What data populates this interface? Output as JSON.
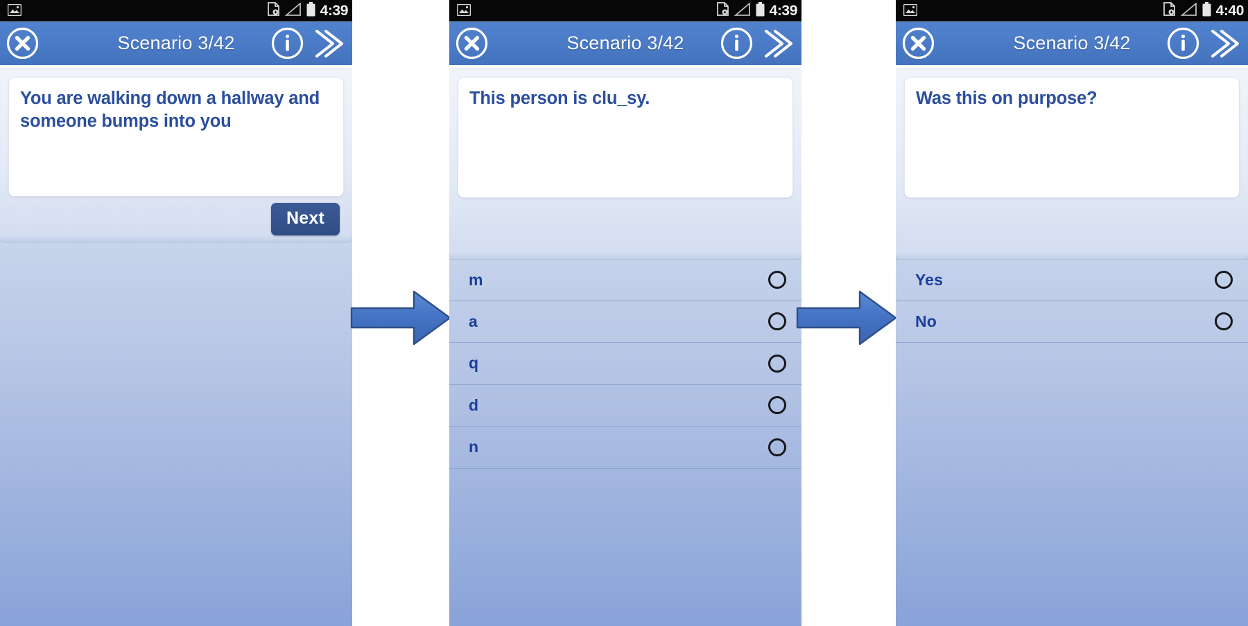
{
  "panels": [
    {
      "id": "scenario-intro",
      "statusbar": {
        "time": "4:39",
        "icons": [
          "image-icon",
          "sd-card-icon",
          "signal-icon",
          "battery-icon"
        ]
      },
      "appbar": {
        "title": "Scenario 3/42",
        "close_label": "✕",
        "info_label": "i",
        "forward_label": "»"
      },
      "card_text": "You are walking down a hallway and someone bumps into you",
      "next_label": "Next",
      "options": []
    },
    {
      "id": "fill-in-the-blank",
      "statusbar": {
        "time": "4:39",
        "icons": [
          "image-icon",
          "sd-card-icon",
          "signal-icon",
          "battery-icon"
        ]
      },
      "appbar": {
        "title": "Scenario 3/42",
        "close_label": "✕",
        "info_label": "i",
        "forward_label": "»"
      },
      "card_text": "This person is clu_sy.",
      "next_label": "",
      "options": [
        {
          "label": "m",
          "selected": false
        },
        {
          "label": "a",
          "selected": false
        },
        {
          "label": "q",
          "selected": false
        },
        {
          "label": "d",
          "selected": false
        },
        {
          "label": "n",
          "selected": false
        }
      ]
    },
    {
      "id": "intent-question",
      "statusbar": {
        "time": "4:40",
        "icons": [
          "image-icon",
          "sd-card-icon",
          "signal-icon",
          "battery-icon"
        ]
      },
      "appbar": {
        "title": "Scenario 3/42",
        "close_label": "✕",
        "info_label": "i",
        "forward_label": "»"
      },
      "card_text": "Was this on purpose?",
      "next_label": "",
      "options": [
        {
          "label": "Yes",
          "selected": false
        },
        {
          "label": "No",
          "selected": false
        }
      ]
    }
  ],
  "flow": {
    "arrows": [
      {
        "name": "flow-arrow-1",
        "direction": "right"
      },
      {
        "name": "flow-arrow-2",
        "direction": "right"
      }
    ]
  },
  "colors": {
    "appbar_blue": "#4c7cc8",
    "text_blue": "#2b4f9e",
    "option_blue": "#1c3f9b",
    "next_button": "#2f4d85",
    "arrow_fill": "#4472c4",
    "arrow_stroke": "#2e4f88",
    "status_bar": "#070707"
  }
}
